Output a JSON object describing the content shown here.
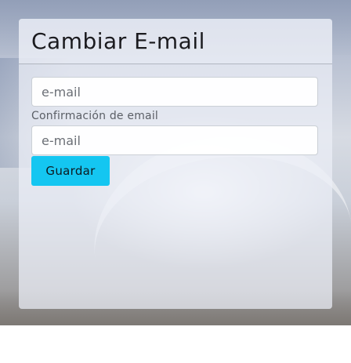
{
  "page": {
    "title": "Cambiar E-mail"
  },
  "form": {
    "email_placeholder": "e-mail",
    "confirm_label": "Confirmación de email",
    "confirm_placeholder": "e-mail",
    "submit_label": "Guardar"
  },
  "colors": {
    "accent": "#14c6f1"
  }
}
